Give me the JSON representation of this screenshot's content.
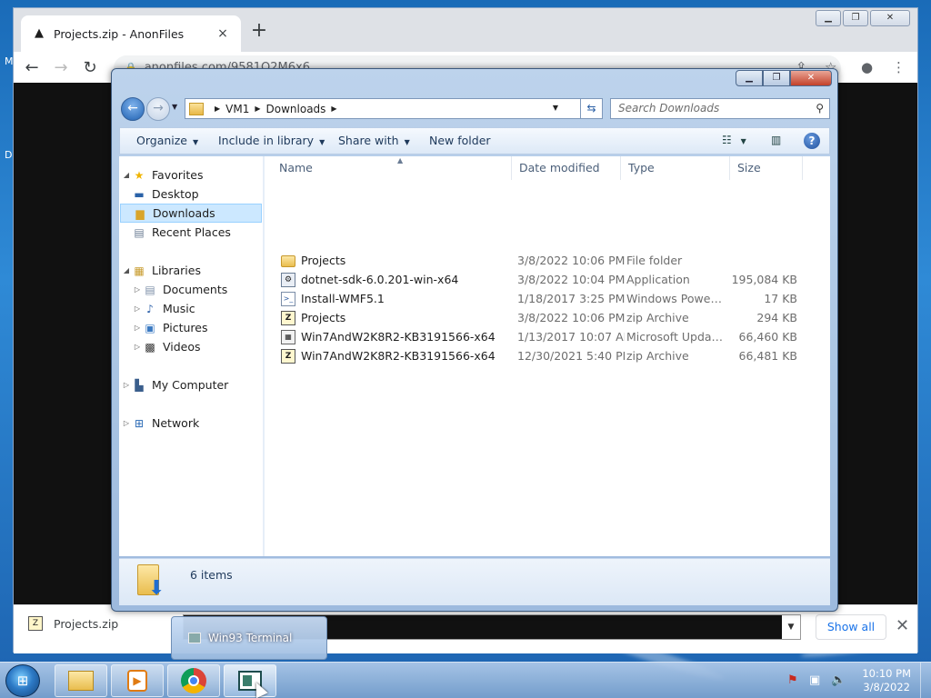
{
  "browser": {
    "tab_title": "Projects.zip - AnonFiles",
    "tab_close": "×",
    "new_tab": "+",
    "url": "anonfiles.com/9581Q2M6x6",
    "window_buttons": {
      "minimize": "▁",
      "maximize": "❐",
      "close": "✕"
    },
    "left_edge_letters": [
      "M",
      "D"
    ],
    "download_bar": {
      "file_name": "Projects.zip",
      "show_all": "Show all",
      "close": "✕"
    }
  },
  "explorer": {
    "window_buttons": {
      "minimize": "▁",
      "maximize": "❐",
      "close": "✕"
    },
    "breadcrumb": [
      "VM1",
      "Downloads"
    ],
    "search_placeholder": "Search Downloads",
    "commands": {
      "organize": "Organize",
      "include_in_library": "Include in library",
      "share_with": "Share with",
      "new_folder": "New folder"
    },
    "nav": {
      "favorites": "Favorites",
      "desktop": "Desktop",
      "downloads": "Downloads",
      "recent_places": "Recent Places",
      "libraries": "Libraries",
      "documents": "Documents",
      "music": "Music",
      "pictures": "Pictures",
      "videos": "Videos",
      "my_computer": "My Computer",
      "network": "Network"
    },
    "columns": {
      "name": "Name",
      "date_modified": "Date modified",
      "type": "Type",
      "size": "Size"
    },
    "files": [
      {
        "icon": "folder-icon",
        "name": "Projects",
        "date": "3/8/2022 10:06 PM",
        "type": "File folder",
        "size": ""
      },
      {
        "icon": "application-icon",
        "name": "dotnet-sdk-6.0.201-win-x64",
        "date": "3/8/2022 10:04 PM",
        "type": "Application",
        "size": "195,084 KB"
      },
      {
        "icon": "powershell-script-icon",
        "name": "Install-WMF5.1",
        "date": "1/18/2017 3:25 PM",
        "type": "Windows PowerS...",
        "size": "17 KB"
      },
      {
        "icon": "zip-archive-icon",
        "name": "Projects",
        "date": "3/8/2022 10:06 PM",
        "type": "zip Archive",
        "size": "294 KB"
      },
      {
        "icon": "update-package-icon",
        "name": "Win7AndW2K8R2-KB3191566-x64",
        "date": "1/13/2017 10:07 AM",
        "type": "Microsoft Update ...",
        "size": "66,460 KB"
      },
      {
        "icon": "zip-archive-icon",
        "name": "Win7AndW2K8R2-KB3191566-x64",
        "date": "12/30/2021 5:40 PM",
        "type": "zip Archive",
        "size": "66,481 KB"
      }
    ],
    "details": {
      "item_count": "6 items"
    }
  },
  "taskbar": {
    "thumbnail_label": "Win93 Terminal",
    "clock_time": "10:10 PM",
    "clock_date": "3/8/2022"
  }
}
